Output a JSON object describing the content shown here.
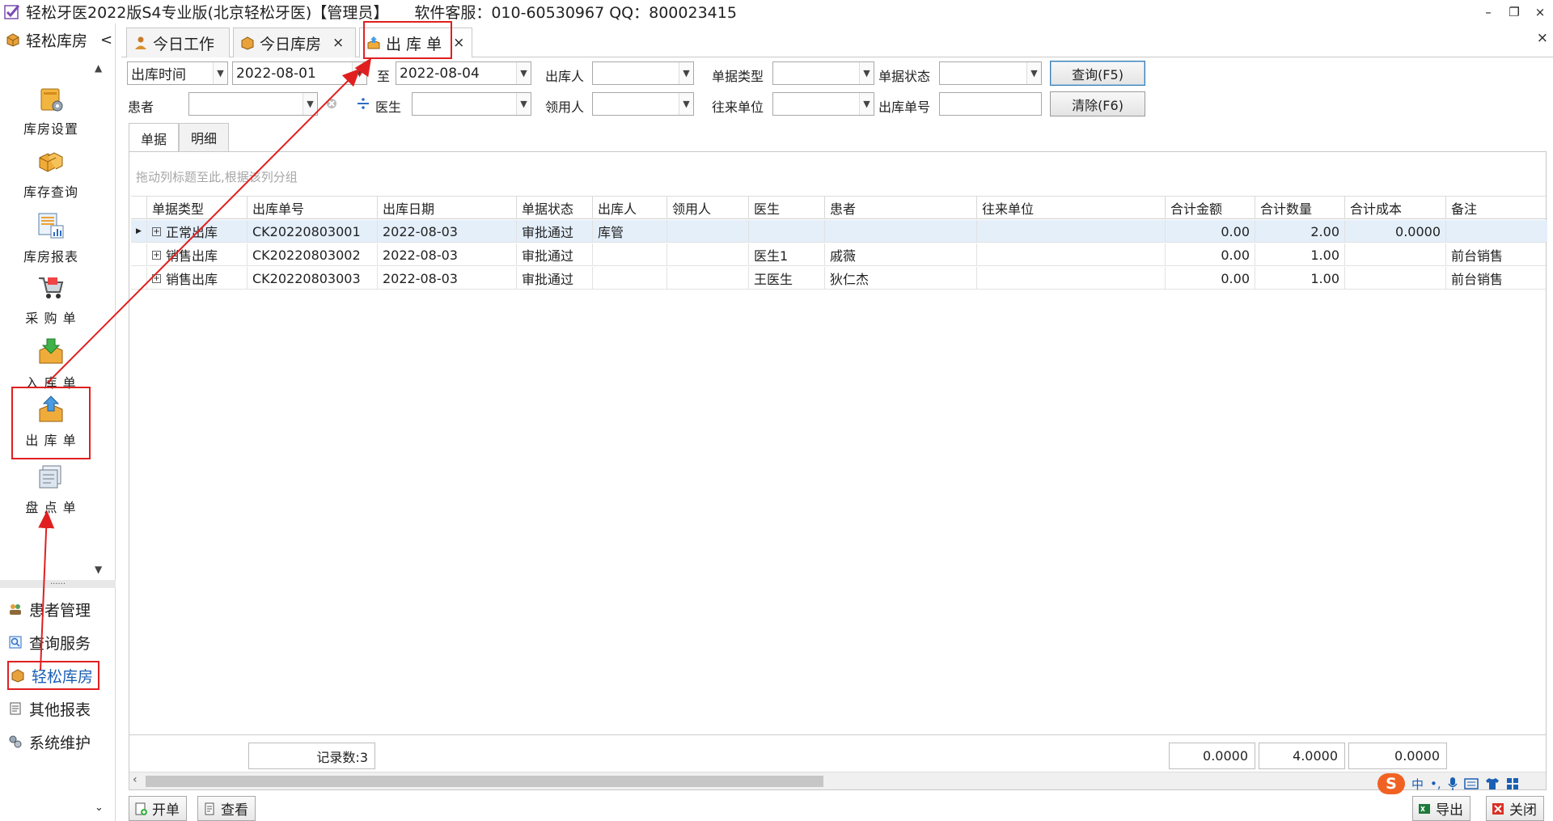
{
  "window": {
    "title": "轻松牙医2022版S4专业版(北京轻松牙医)【管理员】",
    "service": "软件客服：010-60530967 QQ：800023415",
    "minimize": "–",
    "restore": "❐",
    "close": "×"
  },
  "sidebar": {
    "header": "轻松库房",
    "collapse": "<",
    "tiles": [
      {
        "label": "库房设置",
        "icon": "warehouse-settings-icon"
      },
      {
        "label": "库存查询",
        "icon": "inventory-boxes-icon"
      },
      {
        "label": "库房报表",
        "icon": "report-chart-icon"
      },
      {
        "label": "采 购 单",
        "icon": "shopping-cart-icon"
      },
      {
        "label": "入 库 单",
        "icon": "inbound-box-icon"
      },
      {
        "label": "出 库 单",
        "icon": "outbound-box-icon"
      },
      {
        "label": "盘 点 单",
        "icon": "stocktake-icon"
      }
    ],
    "dots": "......",
    "groups": [
      {
        "label": "患者管理",
        "icon": "patients-icon"
      },
      {
        "label": "查询服务",
        "icon": "query-icon"
      },
      {
        "label": "轻松库房",
        "icon": "warehouse-icon"
      },
      {
        "label": "其他报表",
        "icon": "reports-icon"
      },
      {
        "label": "系统维护",
        "icon": "system-maintenance-icon"
      }
    ]
  },
  "tabs": [
    {
      "label": "今日工作",
      "close": ""
    },
    {
      "label": "今日库房",
      "close": "×"
    },
    {
      "label": "出 库 单",
      "close": "×"
    }
  ],
  "tabstrip_close": "×",
  "filters": {
    "time_type": "出库时间",
    "date_from": "2022-08-01",
    "to_label": "至",
    "date_to": "2022-08-04",
    "outbound_person_label": "出库人",
    "doc_type_label": "单据类型",
    "doc_status_label": "单据状态",
    "query_button": "查询(F5)",
    "patient_label": "患者",
    "doctor_label": "医生",
    "recipient_label": "领用人",
    "partner_label": "往来单位",
    "doc_no_label": "出库单号",
    "clear_button": "清除(F6)"
  },
  "subtabs": [
    "单据",
    "明细"
  ],
  "grid": {
    "group_hint": "拖动列标题至此,根据该列分组",
    "columns": [
      "单据类型",
      "出库单号",
      "出库日期",
      "单据状态",
      "出库人",
      "领用人",
      "医生",
      "患者",
      "往来单位",
      "合计金额",
      "合计数量",
      "合计成本",
      "备注"
    ],
    "rows": [
      {
        "type": "正常出库",
        "no": "CK20220803001",
        "date": "2022-08-03",
        "status": "审批通过",
        "outbound": "库管",
        "recipient": "",
        "doctor": "",
        "patient": "",
        "partner": "",
        "amount": "0.00",
        "qty": "2.00",
        "cost": "0.0000",
        "remark": ""
      },
      {
        "type": "销售出库",
        "no": "CK20220803002",
        "date": "2022-08-03",
        "status": "审批通过",
        "outbound": "",
        "recipient": "",
        "doctor": "医生1",
        "patient": "戚薇",
        "partner": "",
        "amount": "0.00",
        "qty": "1.00",
        "cost": "",
        "remark": "前台销售"
      },
      {
        "type": "销售出库",
        "no": "CK20220803003",
        "date": "2022-08-03",
        "status": "审批通过",
        "outbound": "",
        "recipient": "",
        "doctor": "王医生",
        "patient": "狄仁杰",
        "partner": "",
        "amount": "0.00",
        "qty": "1.00",
        "cost": "",
        "remark": "前台销售"
      }
    ],
    "record_count": "记录数:3",
    "sum_amount": "0.0000",
    "sum_qty": "4.0000",
    "sum_cost": "0.0000"
  },
  "bottom": {
    "new_button": "开单",
    "view_button": "查看",
    "export_button": "导出",
    "close_button": "关闭"
  },
  "ime": {
    "logo": "S",
    "lang": "中",
    "punct": "•,"
  },
  "colors": {
    "highlight": "#e02020",
    "selected_row": "#e4effa",
    "active_group": "#1a5fb4"
  }
}
